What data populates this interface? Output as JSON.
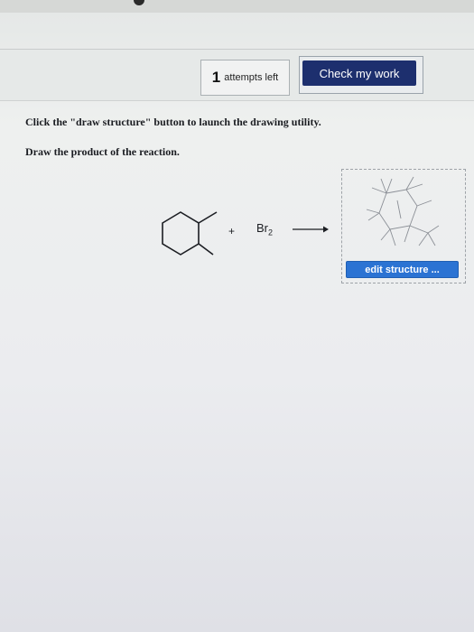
{
  "toolbar": {
    "attempts_number": "1",
    "attempts_label": "attempts left",
    "check_label": "Check my work",
    "check_color": "#1d2f6e"
  },
  "instructions": {
    "line1": "Click the \"draw structure\" button to launch the drawing utility.",
    "line2": "Draw the product of the reaction."
  },
  "reaction": {
    "plus": "+",
    "reagent_main": "Br",
    "reagent_sub": "2",
    "reactant_icon": "methylcyclohexane-structure",
    "arrow_icon": "reaction-arrow-icon"
  },
  "product": {
    "icon": "product-structure-thumbnail",
    "edit_label": "edit structure ...",
    "edit_color": "#2b73d3"
  }
}
